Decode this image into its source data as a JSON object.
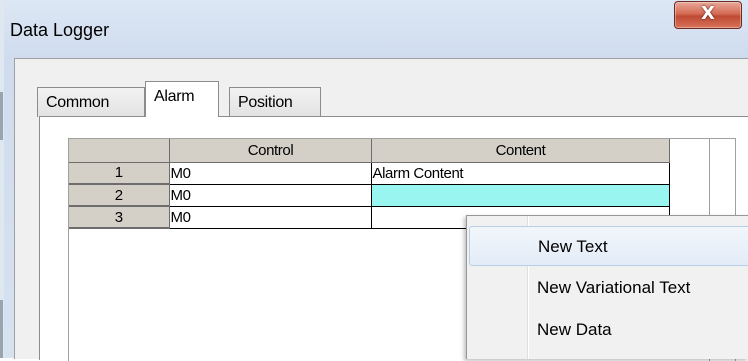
{
  "window": {
    "title": "Data Logger",
    "close_glyph": "X"
  },
  "tabs": [
    {
      "label": "Common",
      "active": false
    },
    {
      "label": "Alarm",
      "active": true
    },
    {
      "label": "Position",
      "active": false
    }
  ],
  "grid": {
    "columns": [
      "Control",
      "Content"
    ],
    "rows": [
      {
        "num": "1",
        "control": "M0",
        "content": "Alarm Content"
      },
      {
        "num": "2",
        "control": "M0",
        "content": ""
      },
      {
        "num": "3",
        "control": "M0",
        "content": ""
      }
    ],
    "selected_color": "#99f5f0"
  },
  "context_menu": {
    "items": [
      "New Text",
      "New Variational Text",
      "New Data"
    ]
  }
}
